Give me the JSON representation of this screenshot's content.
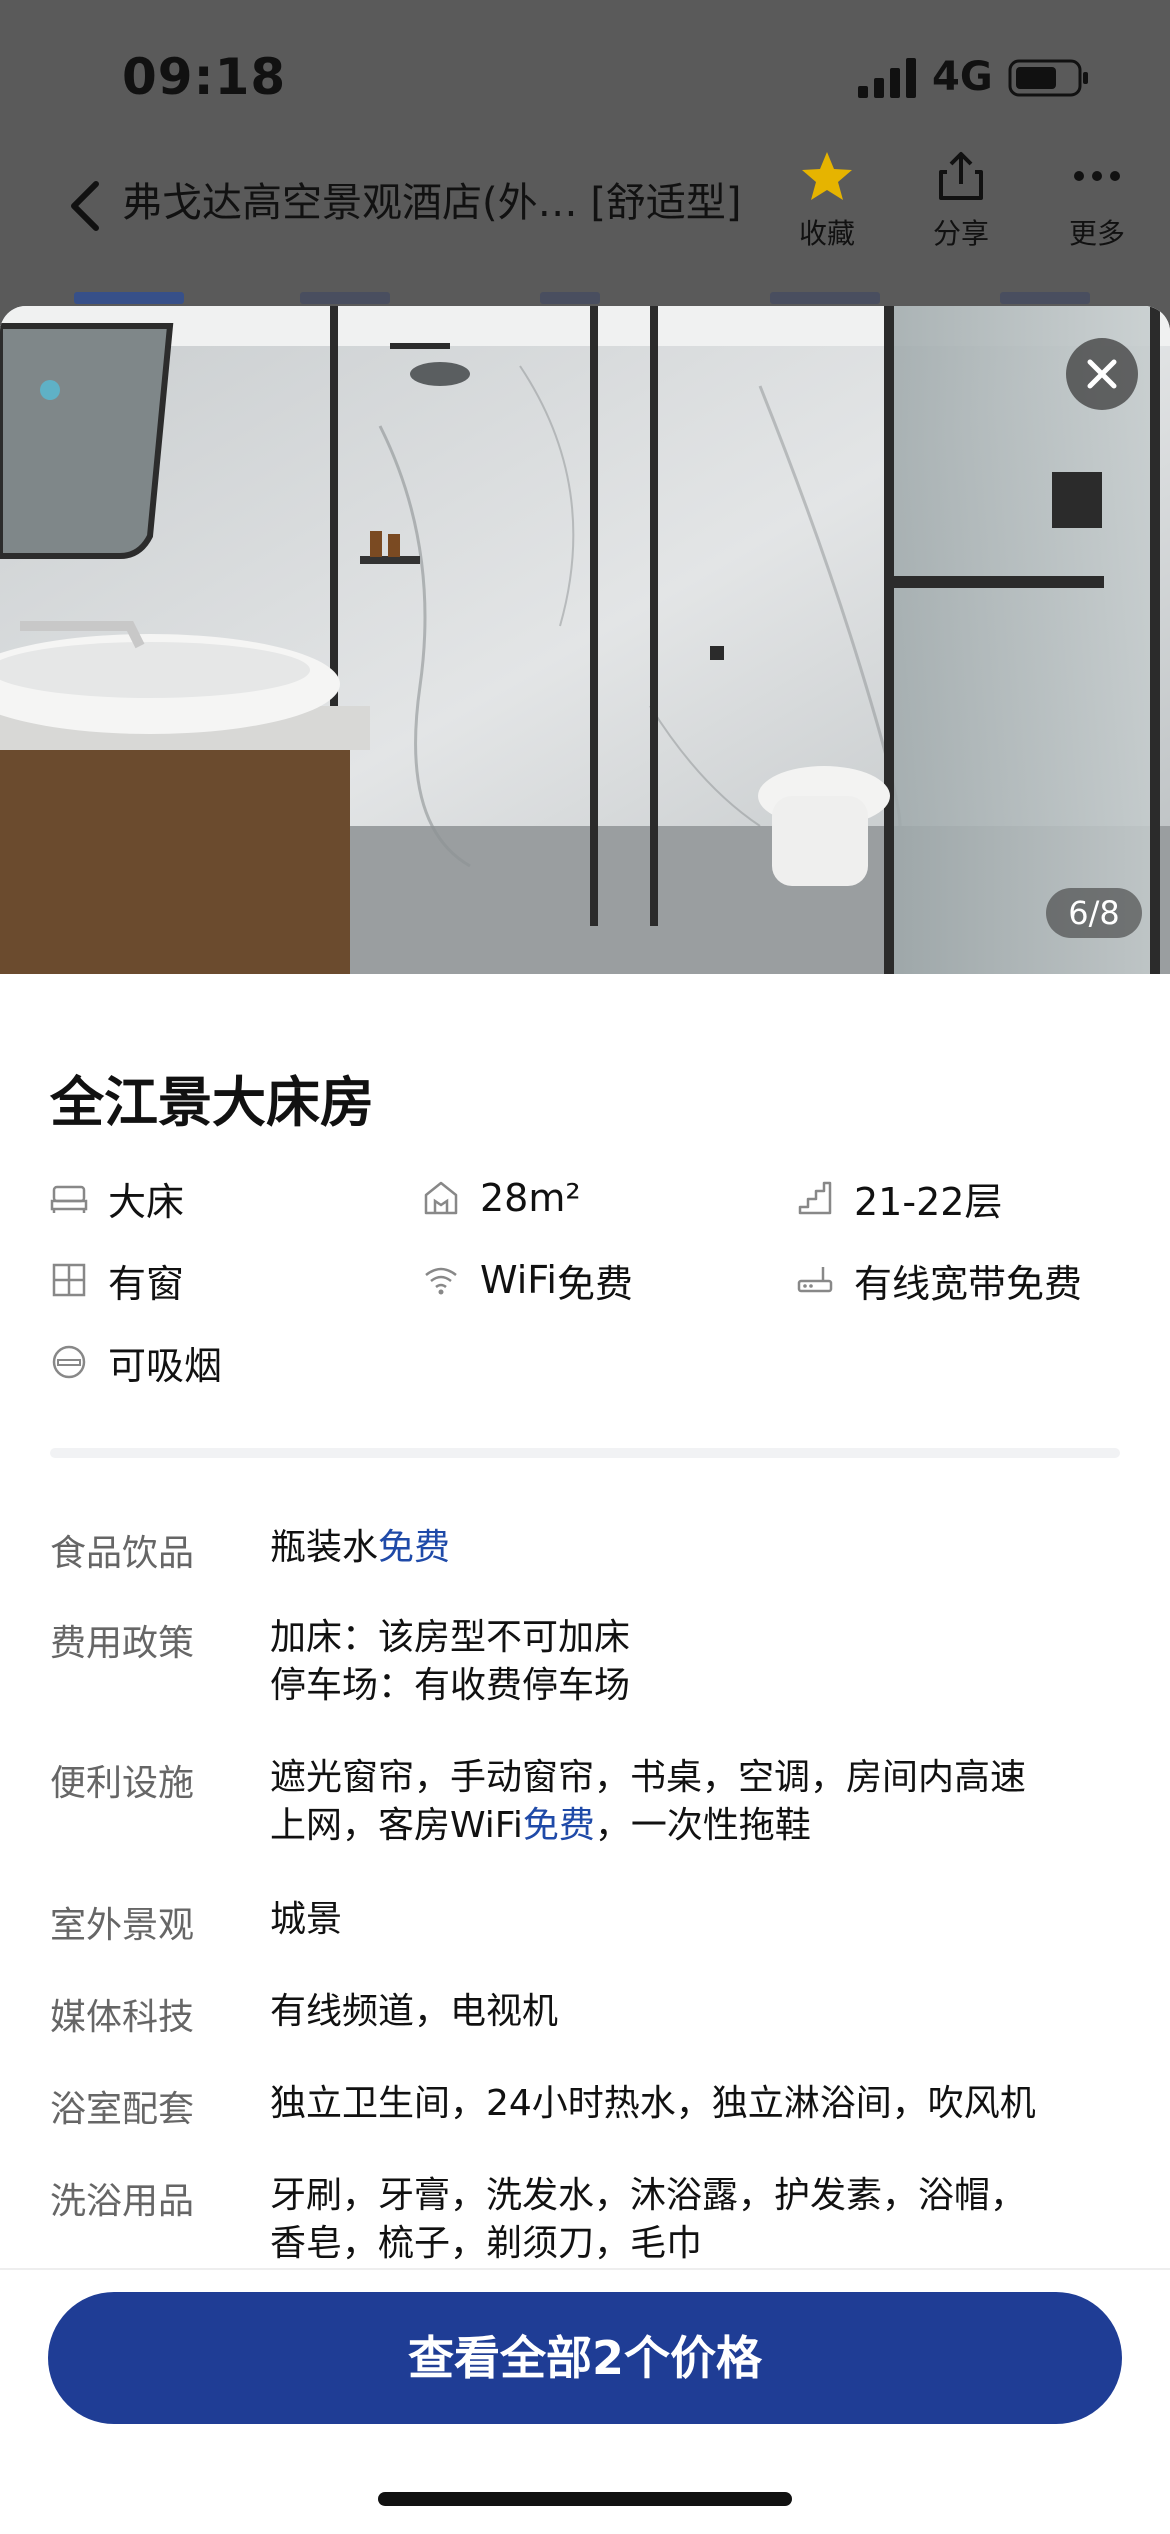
{
  "status_bar": {
    "time": "09:18",
    "network": "4G"
  },
  "header": {
    "title": "弗戈达高空景观酒店(外… [舒适型]",
    "actions": [
      {
        "label": "收藏",
        "icon": "star-icon"
      },
      {
        "label": "分享",
        "icon": "share-icon"
      },
      {
        "label": "更多",
        "icon": "more-icon"
      }
    ]
  },
  "gallery": {
    "counter": "6/8",
    "current": 6,
    "total": 8
  },
  "room": {
    "name": "全江景大床房",
    "features": [
      {
        "icon": "bed-icon",
        "text": "大床",
        "free": ""
      },
      {
        "icon": "area-icon",
        "text": "28m²",
        "free": ""
      },
      {
        "icon": "floor-icon",
        "text": "21-22层",
        "free": ""
      },
      {
        "icon": "window-icon",
        "text": "有窗",
        "free": ""
      },
      {
        "icon": "wifi-icon",
        "text": "WiFi",
        "free": "免费"
      },
      {
        "icon": "broadband-icon",
        "text": "有线宽带",
        "free": "免费"
      },
      {
        "icon": "smoking-icon",
        "text": "可吸烟",
        "free": ""
      }
    ]
  },
  "details": [
    {
      "key": "食品饮品",
      "lines": [
        "瓶装水",
        "免费"
      ]
    },
    {
      "key": "费用政策",
      "line1": "加床：该房型不可加床",
      "line2": "停车场：有收费停车场"
    },
    {
      "key": "便利设施",
      "a": "遮光窗帘，手动窗帘，书桌，空调，房间内高速",
      "b": "上网，客房WiFi",
      "free": "免费",
      "c": "，一次性拖鞋"
    },
    {
      "key": "室外景观",
      "value": "城景"
    },
    {
      "key": "媒体科技",
      "value": "有线频道，电视机"
    },
    {
      "key": "浴室配套",
      "value": "独立卫生间，24小时热水，独立淋浴间，吹风机"
    },
    {
      "key": "洗浴用品",
      "line1": "牙刷，牙膏，洗发水，沐浴露，护发素，浴帽，",
      "line2": "香皂，梳子，剃须刀，毛巾"
    }
  ],
  "footer": {
    "cta": "查看全部2个价格"
  },
  "colors": {
    "accent": "#1f3d95",
    "free": "#1f4aa8",
    "overlay": "#5a5a5a"
  }
}
